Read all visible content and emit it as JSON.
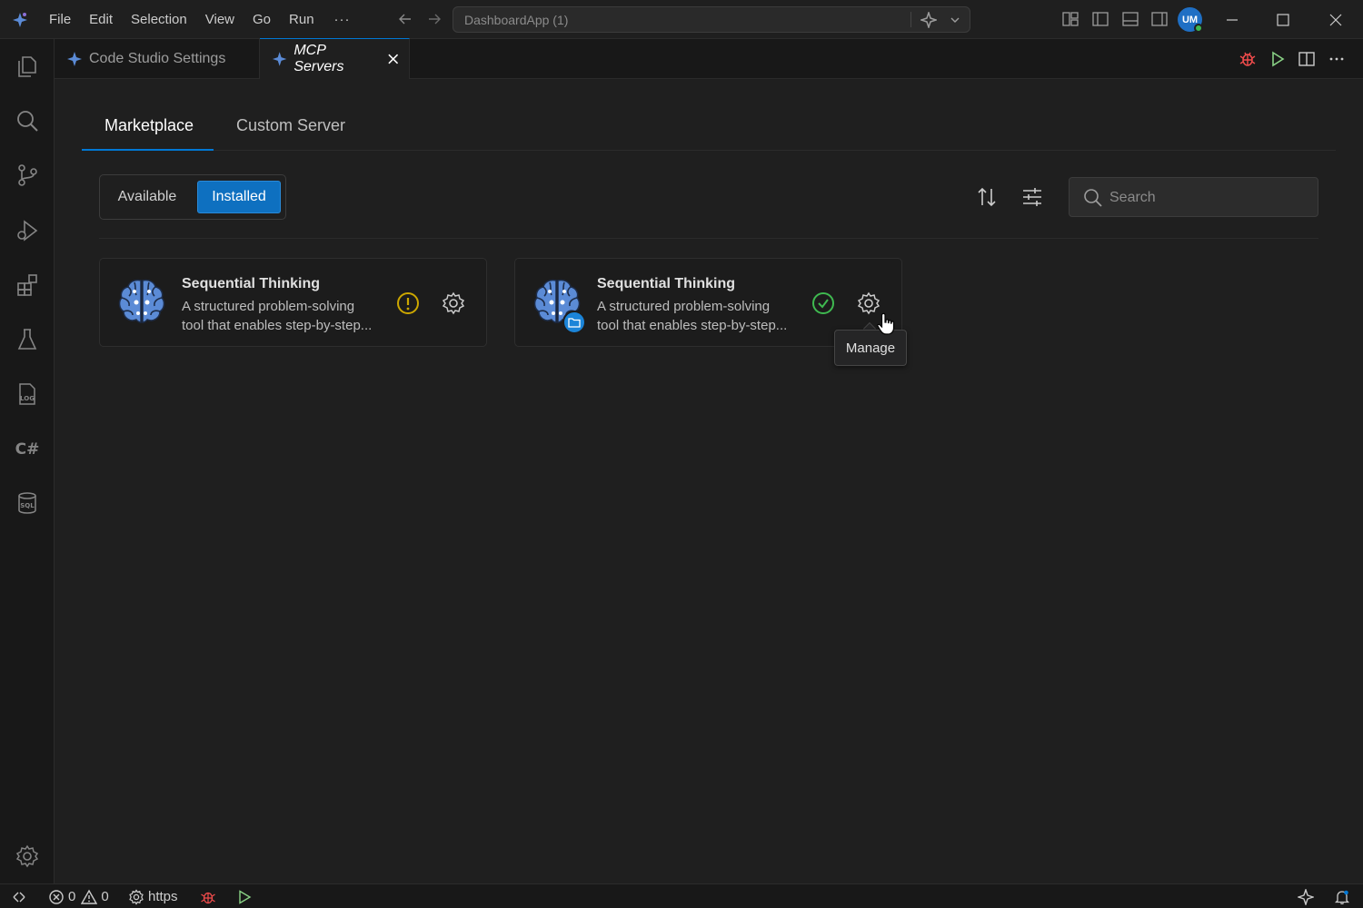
{
  "titlebar": {
    "menu": [
      "File",
      "Edit",
      "Selection",
      "View",
      "Go",
      "Run"
    ],
    "more": "···",
    "command_center": "DashboardApp (1)",
    "avatar_initials": "UM"
  },
  "tabs": [
    {
      "label": "Code Studio Settings",
      "active": false
    },
    {
      "label": "MCP Servers",
      "active": true
    }
  ],
  "main": {
    "tabs": [
      "Marketplace",
      "Custom Server"
    ],
    "active_tab": "Marketplace",
    "filter": {
      "options": [
        "Available",
        "Installed"
      ],
      "selected": "Installed"
    },
    "search": {
      "placeholder": "Search",
      "value": ""
    },
    "cards": [
      {
        "title": "Sequential Thinking",
        "description_line1": "A structured problem-solving",
        "description_line2": "tool that enables step-by-step...",
        "status": "warning-icon",
        "scope_badge": null
      },
      {
        "title": "Sequential Thinking",
        "description_line1": "A structured problem-solving",
        "description_line2": "tool that enables step-by-step...",
        "status": "check-circle-icon",
        "scope_badge": "folder-icon"
      }
    ],
    "tooltip": "Manage"
  },
  "statusbar": {
    "errors": "0",
    "warnings": "0",
    "remote": "https"
  },
  "colors": {
    "accent": "#0078d4",
    "warning": "#cca700",
    "success": "#3fb950",
    "brain": "#5b8bd6",
    "debug": "#f14c4c",
    "run": "#89d185"
  }
}
